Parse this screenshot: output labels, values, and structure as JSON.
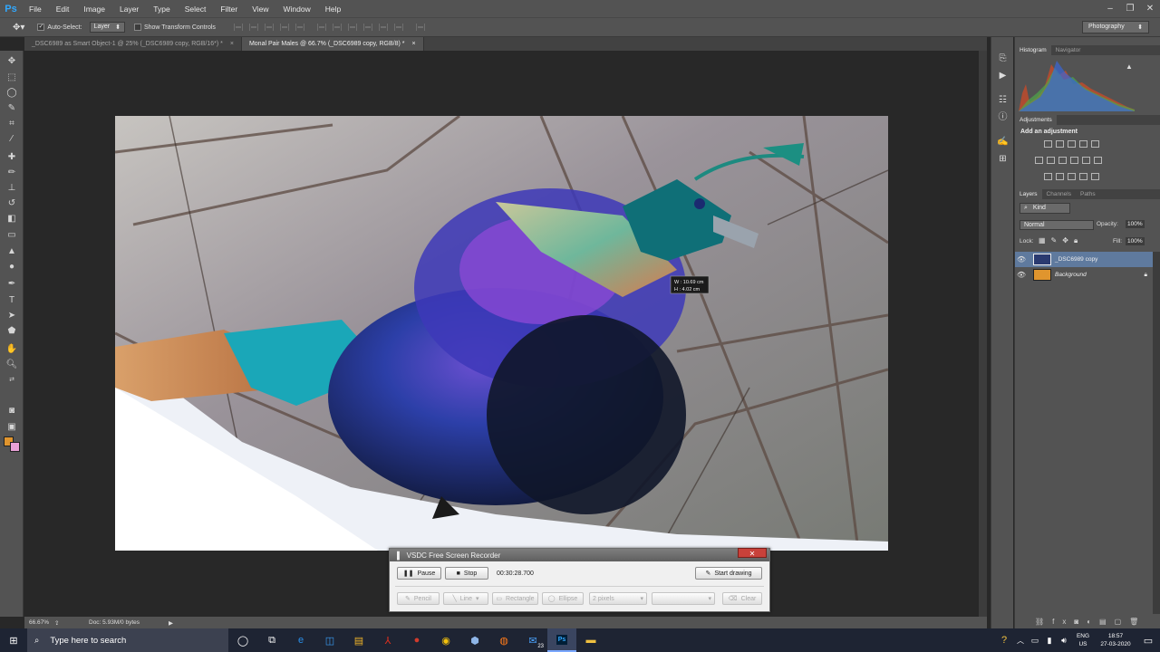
{
  "app": {
    "logo": "Ps",
    "menu": [
      "File",
      "Edit",
      "Image",
      "Layer",
      "Type",
      "Select",
      "Filter",
      "View",
      "Window",
      "Help"
    ],
    "window_controls": [
      "–",
      "❐",
      "✕"
    ]
  },
  "options_bar": {
    "auto_select_label": "Auto-Select:",
    "auto_select_checked": true,
    "auto_select_target": "Layer",
    "show_transform_label": "Show Transform Controls",
    "workspace": "Photography"
  },
  "doc_tabs": [
    {
      "label": "_DSC6989 as Smart Object-1 @ 25% (_DSC6989 copy, RGB/16*) *",
      "active": false
    },
    {
      "label": "Monal Pair Males  @ 66.7% (_DSC6989 copy, RGB/8) *",
      "active": true
    }
  ],
  "canvas": {
    "measure_w": "W : 10.69 cm",
    "measure_h": "H : 4.02 cm"
  },
  "status": {
    "zoom": "66.67%",
    "doc_size": "Doc: 5.93M/0 bytes"
  },
  "panels": {
    "histogram_tab": "Histogram",
    "navigator_tab": "Navigator",
    "adjustments_tab": "Adjustments",
    "add_adjustment": "Add an adjustment",
    "layers_tab": "Layers",
    "channels_tab": "Channels",
    "paths_tab": "Paths",
    "kind_label": "Kind",
    "blend_mode": "Normal",
    "opacity_label": "Opacity:",
    "opacity_value": "100%",
    "lock_label": "Lock:",
    "fill_label": "Fill:",
    "fill_value": "100%",
    "layers": [
      {
        "name": "_DSC6989 copy",
        "selected": true
      },
      {
        "name": "Background",
        "selected": false,
        "locked": true
      }
    ]
  },
  "recorder": {
    "title": "VSDC Free Screen Recorder",
    "pause": "Pause",
    "stop": "Stop",
    "timer": "00:30:28.700",
    "start_drawing": "Start drawing",
    "pencil": "Pencil",
    "line": "Line",
    "rectangle": "Rectangle",
    "ellipse": "Ellipse",
    "size": "2 pixels",
    "clear": "Clear"
  },
  "taskbar": {
    "search_placeholder": "Type here to search",
    "mail_badge": "23",
    "lang_top": "ENG",
    "lang_bottom": "US",
    "time": "18:57",
    "date": "27-03-2020"
  },
  "colors": {
    "foreground": "#e0952e",
    "background": "#e8a0d6",
    "ps_blue": "#31a8ff",
    "panel_gray": "#535353",
    "taskbar": "#1e2433"
  }
}
